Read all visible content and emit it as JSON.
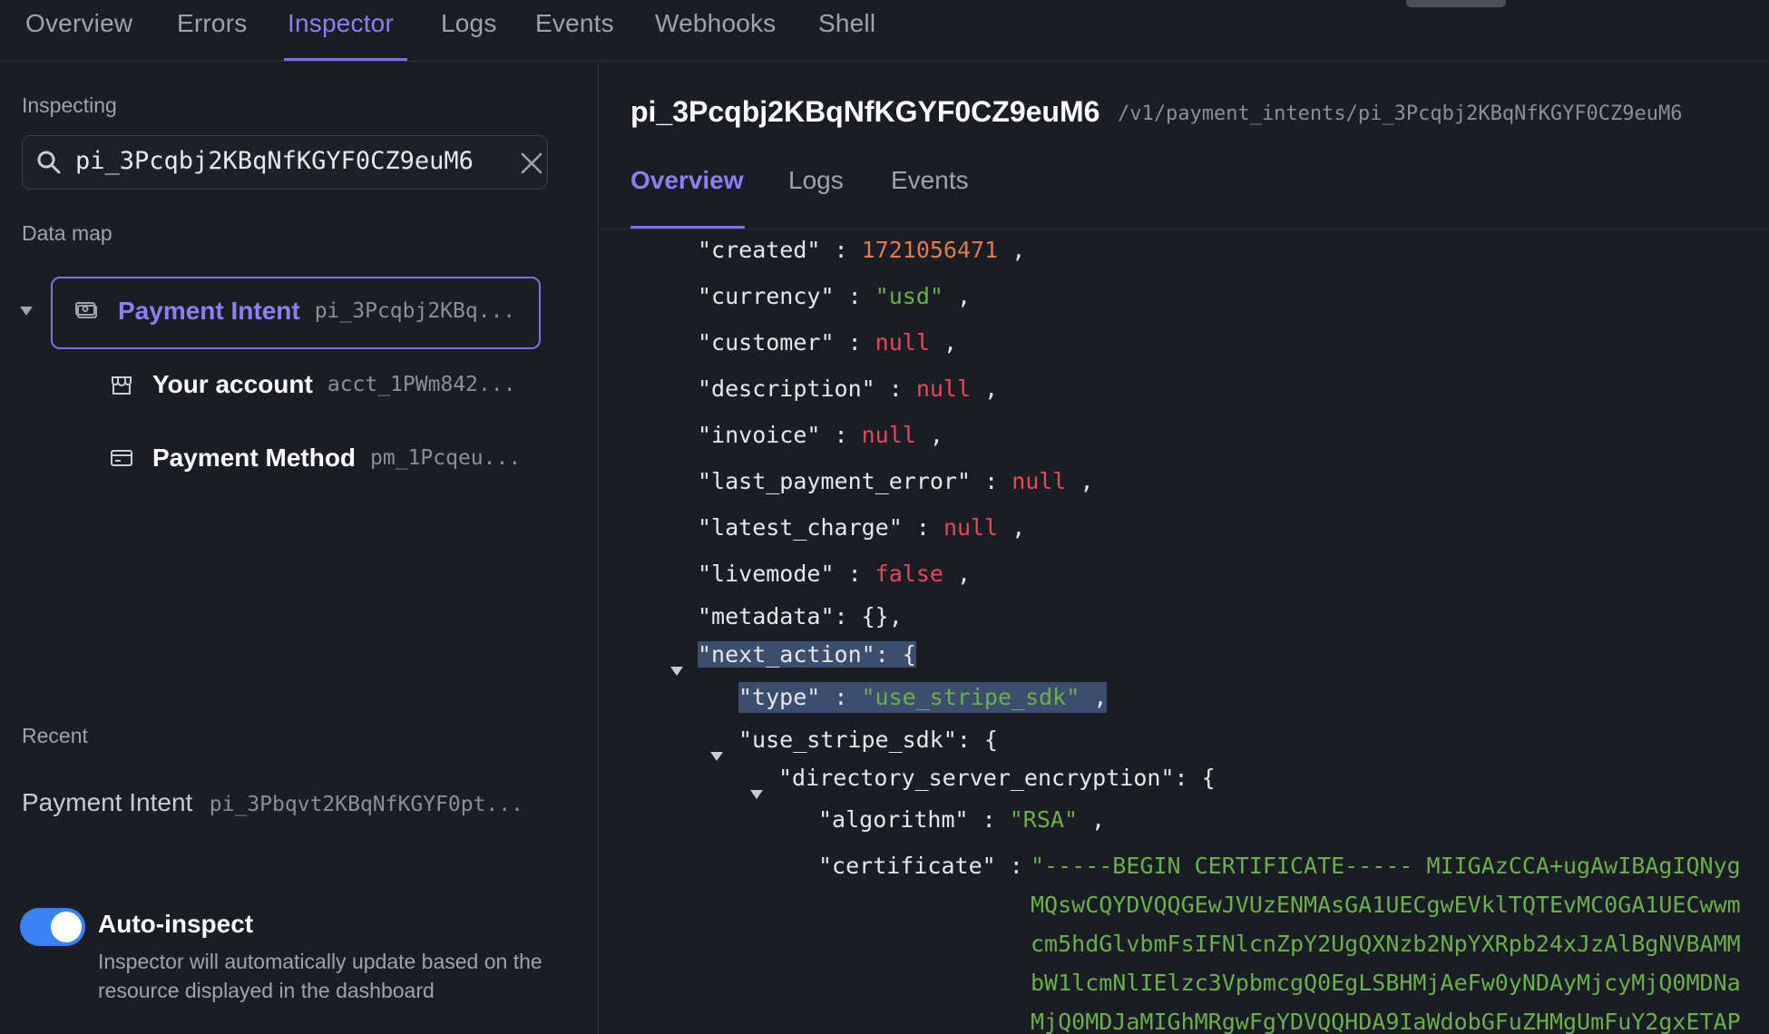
{
  "top_nav": {
    "tabs": [
      "Overview",
      "Errors",
      "Inspector",
      "Logs",
      "Events",
      "Webhooks",
      "Shell"
    ],
    "active": "Inspector"
  },
  "sidebar": {
    "inspecting_label": "Inspecting",
    "search_value": "pi_3Pcqbj2KBqNfKGYF0CZ9euM6",
    "data_map_label": "Data map",
    "data_map": [
      {
        "title": "Payment Intent",
        "id": "pi_3Pcqbj2KBq...",
        "icon": "payment-intent-icon",
        "selected": true
      },
      {
        "title": "Your account",
        "id": "acct_1PWm842...",
        "icon": "storefront-icon",
        "selected": false
      },
      {
        "title": "Payment Method",
        "id": "pm_1Pcqeu...",
        "icon": "card-icon",
        "selected": false
      }
    ],
    "recent_label": "Recent",
    "recent": [
      {
        "title": "Payment Intent",
        "id": "pi_3Pbqvt2KBqNfKGYF0pt..."
      }
    ],
    "auto_inspect": {
      "label": "Auto-inspect",
      "enabled": true,
      "description": "Inspector will automatically update based on the resource displayed in the dashboard"
    }
  },
  "main": {
    "resource_id": "pi_3Pcqbj2KBqNfKGYF0CZ9euM6",
    "resource_path": "/v1/payment_intents/pi_3Pcqbj2KBqNfKGYF0CZ9euM6",
    "tabs": [
      "Overview",
      "Logs",
      "Events"
    ],
    "active_tab": "Overview",
    "json": {
      "created_key": "\"created\"",
      "created_val": "1721056471",
      "currency_key": "\"currency\"",
      "currency_val": "\"usd\"",
      "customer_key": "\"customer\"",
      "customer_val": "null",
      "description_key": "\"description\"",
      "description_val": "null",
      "invoice_key": "\"invoice\"",
      "invoice_val": "null",
      "last_payment_error_key": "\"last_payment_error\"",
      "last_payment_error_val": "null",
      "latest_charge_key": "\"latest_charge\"",
      "latest_charge_val": "null",
      "livemode_key": "\"livemode\"",
      "livemode_val": "false",
      "metadata_line": "\"metadata\": {},",
      "next_action_line": "\"next_action\": {",
      "type_key": "\"type\"",
      "type_val": "\"use_stripe_sdk\"",
      "use_stripe_sdk_line": "\"use_stripe_sdk\": {",
      "dse_line": "\"directory_server_encryption\": {",
      "algorithm_key": "\"algorithm\"",
      "algorithm_val": "\"RSA\"",
      "certificate_key": "\"certificate\"",
      "certificate_lines": [
        "\"-----BEGIN CERTIFICATE----- MIIGAzCCA+ugAwIBAgIQNyg",
        "MQswCQYDVQQGEwJVUzENMAsGA1UECgwEVklTQTEvMC0GA1UECwwm",
        "cm5hdGlvbmFsIFNlcnZpY2UgQXNzb2NpYXRpb24xJzAlBgNVBAMM",
        "bW1lcmNlIElzc3VpbmcgQ0EgLSBHMjAeFw0yNDAyMjcyMjQ0MDNa",
        "MjQ0MDJaMIGhMRgwFgYDVQQHDA9IaWdobGFuZHMgUmFuY2gxETAP"
      ]
    }
  }
}
